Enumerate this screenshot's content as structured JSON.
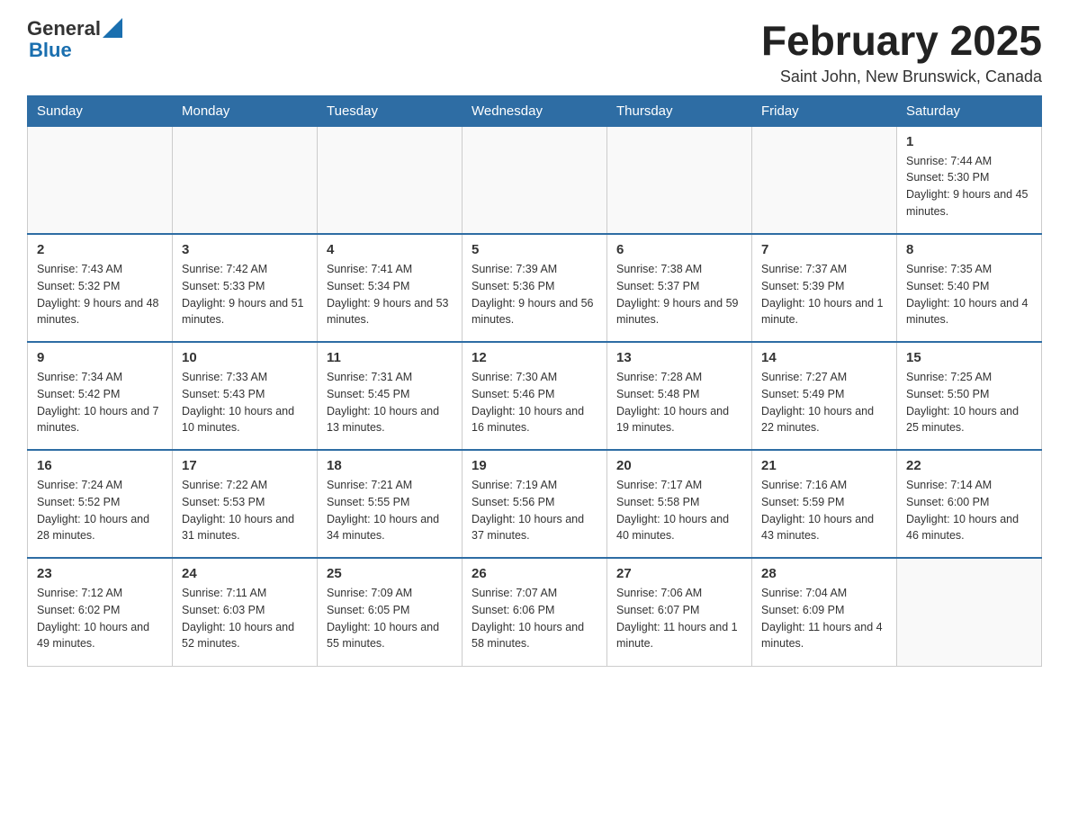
{
  "header": {
    "logo_general": "General",
    "logo_blue": "Blue",
    "title": "February 2025",
    "location": "Saint John, New Brunswick, Canada"
  },
  "days_of_week": [
    "Sunday",
    "Monday",
    "Tuesday",
    "Wednesday",
    "Thursday",
    "Friday",
    "Saturday"
  ],
  "weeks": [
    [
      {
        "day": "",
        "info": ""
      },
      {
        "day": "",
        "info": ""
      },
      {
        "day": "",
        "info": ""
      },
      {
        "day": "",
        "info": ""
      },
      {
        "day": "",
        "info": ""
      },
      {
        "day": "",
        "info": ""
      },
      {
        "day": "1",
        "info": "Sunrise: 7:44 AM\nSunset: 5:30 PM\nDaylight: 9 hours and 45 minutes."
      }
    ],
    [
      {
        "day": "2",
        "info": "Sunrise: 7:43 AM\nSunset: 5:32 PM\nDaylight: 9 hours and 48 minutes."
      },
      {
        "day": "3",
        "info": "Sunrise: 7:42 AM\nSunset: 5:33 PM\nDaylight: 9 hours and 51 minutes."
      },
      {
        "day": "4",
        "info": "Sunrise: 7:41 AM\nSunset: 5:34 PM\nDaylight: 9 hours and 53 minutes."
      },
      {
        "day": "5",
        "info": "Sunrise: 7:39 AM\nSunset: 5:36 PM\nDaylight: 9 hours and 56 minutes."
      },
      {
        "day": "6",
        "info": "Sunrise: 7:38 AM\nSunset: 5:37 PM\nDaylight: 9 hours and 59 minutes."
      },
      {
        "day": "7",
        "info": "Sunrise: 7:37 AM\nSunset: 5:39 PM\nDaylight: 10 hours and 1 minute."
      },
      {
        "day": "8",
        "info": "Sunrise: 7:35 AM\nSunset: 5:40 PM\nDaylight: 10 hours and 4 minutes."
      }
    ],
    [
      {
        "day": "9",
        "info": "Sunrise: 7:34 AM\nSunset: 5:42 PM\nDaylight: 10 hours and 7 minutes."
      },
      {
        "day": "10",
        "info": "Sunrise: 7:33 AM\nSunset: 5:43 PM\nDaylight: 10 hours and 10 minutes."
      },
      {
        "day": "11",
        "info": "Sunrise: 7:31 AM\nSunset: 5:45 PM\nDaylight: 10 hours and 13 minutes."
      },
      {
        "day": "12",
        "info": "Sunrise: 7:30 AM\nSunset: 5:46 PM\nDaylight: 10 hours and 16 minutes."
      },
      {
        "day": "13",
        "info": "Sunrise: 7:28 AM\nSunset: 5:48 PM\nDaylight: 10 hours and 19 minutes."
      },
      {
        "day": "14",
        "info": "Sunrise: 7:27 AM\nSunset: 5:49 PM\nDaylight: 10 hours and 22 minutes."
      },
      {
        "day": "15",
        "info": "Sunrise: 7:25 AM\nSunset: 5:50 PM\nDaylight: 10 hours and 25 minutes."
      }
    ],
    [
      {
        "day": "16",
        "info": "Sunrise: 7:24 AM\nSunset: 5:52 PM\nDaylight: 10 hours and 28 minutes."
      },
      {
        "day": "17",
        "info": "Sunrise: 7:22 AM\nSunset: 5:53 PM\nDaylight: 10 hours and 31 minutes."
      },
      {
        "day": "18",
        "info": "Sunrise: 7:21 AM\nSunset: 5:55 PM\nDaylight: 10 hours and 34 minutes."
      },
      {
        "day": "19",
        "info": "Sunrise: 7:19 AM\nSunset: 5:56 PM\nDaylight: 10 hours and 37 minutes."
      },
      {
        "day": "20",
        "info": "Sunrise: 7:17 AM\nSunset: 5:58 PM\nDaylight: 10 hours and 40 minutes."
      },
      {
        "day": "21",
        "info": "Sunrise: 7:16 AM\nSunset: 5:59 PM\nDaylight: 10 hours and 43 minutes."
      },
      {
        "day": "22",
        "info": "Sunrise: 7:14 AM\nSunset: 6:00 PM\nDaylight: 10 hours and 46 minutes."
      }
    ],
    [
      {
        "day": "23",
        "info": "Sunrise: 7:12 AM\nSunset: 6:02 PM\nDaylight: 10 hours and 49 minutes."
      },
      {
        "day": "24",
        "info": "Sunrise: 7:11 AM\nSunset: 6:03 PM\nDaylight: 10 hours and 52 minutes."
      },
      {
        "day": "25",
        "info": "Sunrise: 7:09 AM\nSunset: 6:05 PM\nDaylight: 10 hours and 55 minutes."
      },
      {
        "day": "26",
        "info": "Sunrise: 7:07 AM\nSunset: 6:06 PM\nDaylight: 10 hours and 58 minutes."
      },
      {
        "day": "27",
        "info": "Sunrise: 7:06 AM\nSunset: 6:07 PM\nDaylight: 11 hours and 1 minute."
      },
      {
        "day": "28",
        "info": "Sunrise: 7:04 AM\nSunset: 6:09 PM\nDaylight: 11 hours and 4 minutes."
      },
      {
        "day": "",
        "info": ""
      }
    ]
  ]
}
